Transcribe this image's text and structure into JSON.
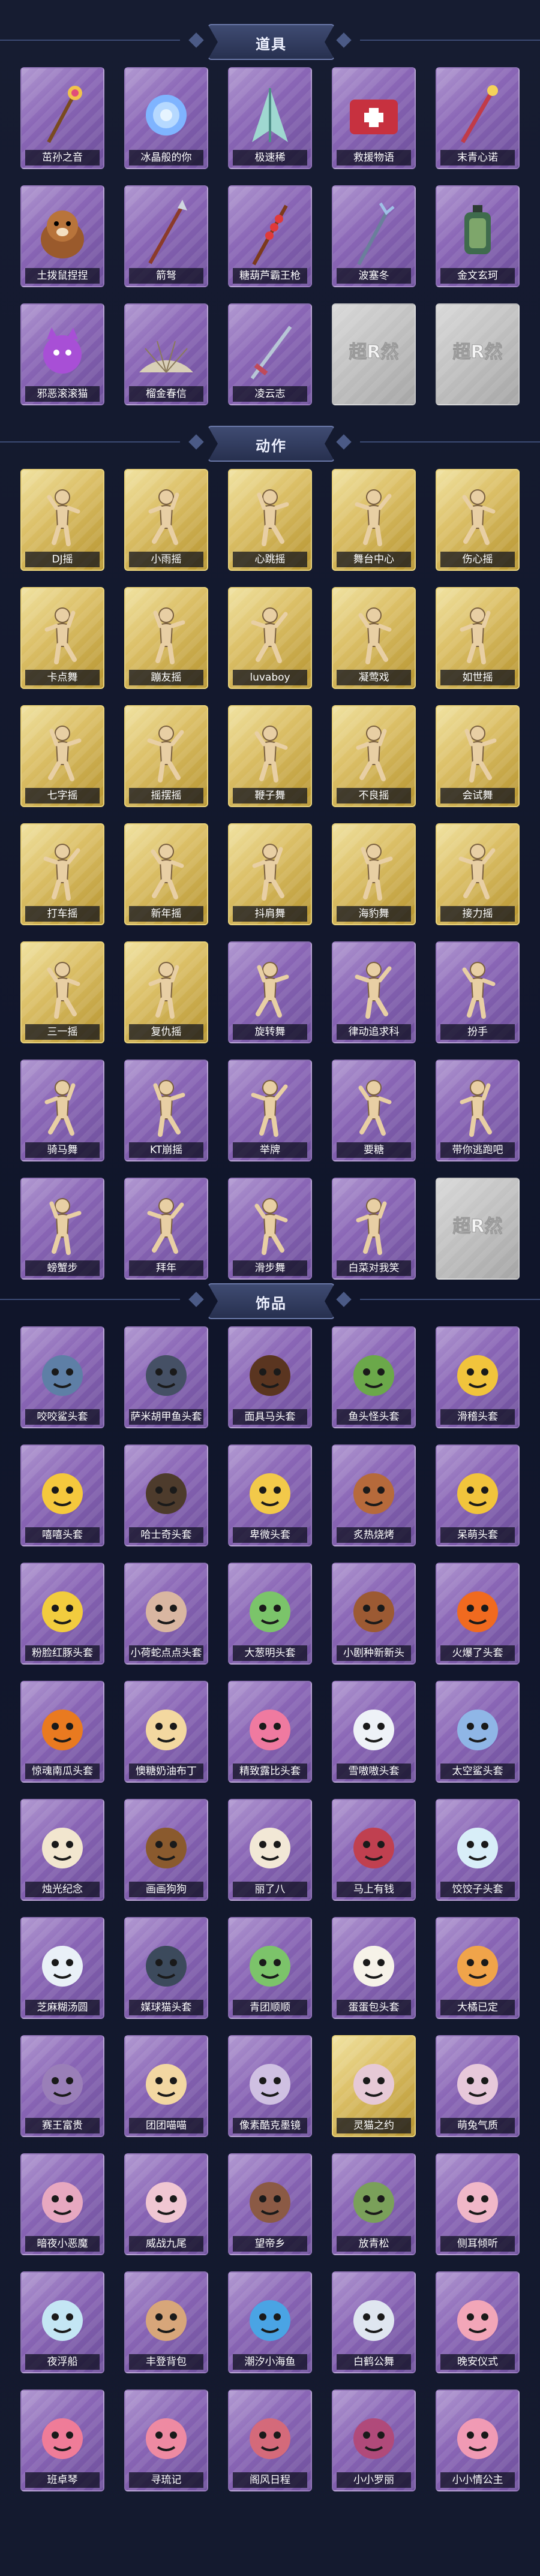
{
  "colors": {
    "background": "#141a2f",
    "rare_card": "#8a66b6",
    "legendary_card": "#dcc068",
    "locked_card": "#bfbfbf",
    "label_bg": "#0a0c1a",
    "section_ribbon": "#323c5f"
  },
  "sections": [
    {
      "title": "道具",
      "items": [
        {
          "label": "茁孙之音",
          "rarity": "purple",
          "icon": "staff-icon"
        },
        {
          "label": "冰晶般的你",
          "rarity": "purple",
          "icon": "crystal-flower-icon"
        },
        {
          "label": "极速稀",
          "rarity": "purple",
          "icon": "feather-wings-icon"
        },
        {
          "label": "救援物语",
          "rarity": "purple",
          "icon": "medkit-icon"
        },
        {
          "label": "末青心诺",
          "rarity": "purple",
          "icon": "wand-icon"
        },
        {
          "label": "土拨鼠捏捏",
          "rarity": "purple",
          "icon": "groundhog-icon"
        },
        {
          "label": "箭弩",
          "rarity": "purple",
          "icon": "spear-icon"
        },
        {
          "label": "糖葫芦霸王枪",
          "rarity": "purple",
          "icon": "candied-spear-icon"
        },
        {
          "label": "波塞冬",
          "rarity": "purple",
          "icon": "trident-icon"
        },
        {
          "label": "金文玄珂",
          "rarity": "purple",
          "icon": "lantern-icon"
        },
        {
          "label": "邪恶滚滚猫",
          "rarity": "purple",
          "icon": "purple-cat-icon"
        },
        {
          "label": "榴金春信",
          "rarity": "purple",
          "icon": "fan-icon"
        },
        {
          "label": "凌云志",
          "rarity": "purple",
          "icon": "sword-icon"
        },
        {
          "label": "",
          "rarity": "gray",
          "icon": "locked-logo-icon"
        },
        {
          "label": "",
          "rarity": "gray",
          "icon": "locked-logo-icon"
        }
      ]
    },
    {
      "title": "动作",
      "items": [
        {
          "label": "DJ摇",
          "rarity": "gold",
          "icon": "dance-pose-icon"
        },
        {
          "label": "小雨摇",
          "rarity": "gold",
          "icon": "dance-pose-icon"
        },
        {
          "label": "心跳摇",
          "rarity": "gold",
          "icon": "dance-pose-icon"
        },
        {
          "label": "舞台中心",
          "rarity": "gold",
          "icon": "dance-pose-icon"
        },
        {
          "label": "伤心摇",
          "rarity": "gold",
          "icon": "dance-pose-icon"
        },
        {
          "label": "卡点舞",
          "rarity": "gold",
          "icon": "dance-pose-icon"
        },
        {
          "label": "蹦友摇",
          "rarity": "gold",
          "icon": "dance-pose-icon"
        },
        {
          "label": "luvaboy",
          "rarity": "gold",
          "icon": "dance-pose-icon"
        },
        {
          "label": "凝莺戏",
          "rarity": "gold",
          "icon": "dance-pose-icon"
        },
        {
          "label": "如世摇",
          "rarity": "gold",
          "icon": "dance-pose-icon"
        },
        {
          "label": "七字摇",
          "rarity": "gold",
          "icon": "dance-pose-icon"
        },
        {
          "label": "摇摆摇",
          "rarity": "gold",
          "icon": "dance-pose-icon"
        },
        {
          "label": "鞭子舞",
          "rarity": "gold",
          "icon": "dance-pose-icon"
        },
        {
          "label": "不良摇",
          "rarity": "gold",
          "icon": "dance-pose-icon"
        },
        {
          "label": "会试舞",
          "rarity": "gold",
          "icon": "dance-pose-icon"
        },
        {
          "label": "打车摇",
          "rarity": "gold",
          "icon": "dance-pose-icon"
        },
        {
          "label": "新年摇",
          "rarity": "gold",
          "icon": "dance-pose-icon"
        },
        {
          "label": "抖肩舞",
          "rarity": "gold",
          "icon": "dance-pose-icon"
        },
        {
          "label": "海豹舞",
          "rarity": "gold",
          "icon": "dance-pose-icon"
        },
        {
          "label": "接力摇",
          "rarity": "gold",
          "icon": "dance-pose-icon"
        },
        {
          "label": "三一摇",
          "rarity": "gold",
          "icon": "dance-pose-icon"
        },
        {
          "label": "复仇摇",
          "rarity": "gold",
          "icon": "dance-pose-icon"
        },
        {
          "label": "旋转舞",
          "rarity": "purple",
          "icon": "dance-pose-icon"
        },
        {
          "label": "律动追求科",
          "rarity": "purple",
          "icon": "dance-pose-icon"
        },
        {
          "label": "扮手",
          "rarity": "purple",
          "icon": "dance-pose-icon"
        },
        {
          "label": "骑马舞",
          "rarity": "purple",
          "icon": "dance-pose-icon"
        },
        {
          "label": "KT崩摇",
          "rarity": "purple",
          "icon": "dance-pose-icon"
        },
        {
          "label": "举牌",
          "rarity": "purple",
          "icon": "dance-pose-icon"
        },
        {
          "label": "要糖",
          "rarity": "purple",
          "icon": "dance-pose-icon"
        },
        {
          "label": "带你逃跑吧",
          "rarity": "purple",
          "icon": "dance-pose-icon"
        },
        {
          "label": "螃蟹步",
          "rarity": "purple",
          "icon": "dance-pose-icon"
        },
        {
          "label": "拜年",
          "rarity": "purple",
          "icon": "dance-pose-icon"
        },
        {
          "label": "滑步舞",
          "rarity": "purple",
          "icon": "dance-pose-icon"
        },
        {
          "label": "白菜对我笑",
          "rarity": "purple",
          "icon": "dance-pose-icon"
        },
        {
          "label": "",
          "rarity": "gray",
          "icon": "locked-logo-icon"
        }
      ]
    },
    {
      "title": "饰品",
      "items": [
        {
          "label": "咬咬鲨头套",
          "rarity": "purple",
          "icon": "shark-head-icon"
        },
        {
          "label": "萨米胡甲鱼头套",
          "rarity": "purple",
          "icon": "seal-head-icon"
        },
        {
          "label": "面具马头套",
          "rarity": "purple",
          "icon": "horse-head-icon"
        },
        {
          "label": "鱼头怪头套",
          "rarity": "purple",
          "icon": "fish-head-icon"
        },
        {
          "label": "滑稽头套",
          "rarity": "purple",
          "icon": "funny-face-icon"
        },
        {
          "label": "嘻嘻头套",
          "rarity": "purple",
          "icon": "grin-face-icon"
        },
        {
          "label": "哈士奇头套",
          "rarity": "purple",
          "icon": "husky-head-icon"
        },
        {
          "label": "卑微头套",
          "rarity": "purple",
          "icon": "humble-face-icon"
        },
        {
          "label": "炙热烧烤",
          "rarity": "purple",
          "icon": "bbq-face-icon"
        },
        {
          "label": "呆萌头套",
          "rarity": "purple",
          "icon": "dazed-face-icon"
        },
        {
          "label": "粉脸红豚头套",
          "rarity": "purple",
          "icon": "pikachu-head-icon"
        },
        {
          "label": "小荷蛇点点头套",
          "rarity": "purple",
          "icon": "snake-head-icon"
        },
        {
          "label": "大葱明头套",
          "rarity": "purple",
          "icon": "scallion-head-icon"
        },
        {
          "label": "小剧种新新头",
          "rarity": "purple",
          "icon": "bear-head-icon"
        },
        {
          "label": "火爆了头套",
          "rarity": "purple",
          "icon": "fire-head-icon"
        },
        {
          "label": "惊魂南瓜头套",
          "rarity": "purple",
          "icon": "pumpkin-head-icon"
        },
        {
          "label": "懊糖奶油布丁",
          "rarity": "purple",
          "icon": "pudding-head-icon"
        },
        {
          "label": "精致露比头套",
          "rarity": "purple",
          "icon": "pink-beaver-head-icon"
        },
        {
          "label": "雪嗷嗷头套",
          "rarity": "purple",
          "icon": "snowman-head-icon"
        },
        {
          "label": "太空鲨头套",
          "rarity": "purple",
          "icon": "space-shark-head-icon"
        },
        {
          "label": "烛光纪念",
          "rarity": "purple",
          "icon": "candle-head-icon"
        },
        {
          "label": "画画狗狗",
          "rarity": "purple",
          "icon": "dog-head-icon"
        },
        {
          "label": "丽了八",
          "rarity": "purple",
          "icon": "bun-head-icon"
        },
        {
          "label": "马上有钱",
          "rarity": "purple",
          "icon": "horse-hat-icon"
        },
        {
          "label": "饺饺子头套",
          "rarity": "purple",
          "icon": "dumpling-head-icon"
        },
        {
          "label": "芝麻糊汤圆",
          "rarity": "purple",
          "icon": "tangyuan-head-icon"
        },
        {
          "label": "媒球猫头套",
          "rarity": "purple",
          "icon": "black-cat-head-icon"
        },
        {
          "label": "青团顺顺",
          "rarity": "purple",
          "icon": "green-bun-head-icon"
        },
        {
          "label": "蛋蛋包头套",
          "rarity": "purple",
          "icon": "egg-head-icon"
        },
        {
          "label": "大橘已定",
          "rarity": "purple",
          "icon": "orange-head-icon"
        },
        {
          "label": "赛王富贵",
          "rarity": "purple",
          "icon": "hat-accessory-icon"
        },
        {
          "label": "团团喵喵",
          "rarity": "purple",
          "icon": "cat-head-icon"
        },
        {
          "label": "像素酷克墨镜",
          "rarity": "purple",
          "icon": "pixel-glasses-icon"
        },
        {
          "label": "灵猫之约",
          "rarity": "gold",
          "icon": "spirit-cat-icon"
        },
        {
          "label": "萌兔气质",
          "rarity": "purple",
          "icon": "rabbit-head-icon"
        },
        {
          "label": "暗夜小恶魔",
          "rarity": "purple",
          "icon": "devil-head-icon"
        },
        {
          "label": "威战九尾",
          "rarity": "purple",
          "icon": "fox-head-icon"
        },
        {
          "label": "望帝乡",
          "rarity": "purple",
          "icon": "beast-head-icon"
        },
        {
          "label": "放青松",
          "rarity": "purple",
          "icon": "bonsai-head-icon"
        },
        {
          "label": "侧耳倾听",
          "rarity": "purple",
          "icon": "pink-bunny-head-icon"
        },
        {
          "label": "夜浮船",
          "rarity": "purple",
          "icon": "ice-crown-icon"
        },
        {
          "label": "丰登背包",
          "rarity": "purple",
          "icon": "cake-backpack-icon"
        },
        {
          "label": "潮汐小海鱼",
          "rarity": "purple",
          "icon": "blue-cat-icon"
        },
        {
          "label": "白鹤公舞",
          "rarity": "purple",
          "icon": "ghost-head-icon"
        },
        {
          "label": "晚安仪式",
          "rarity": "purple",
          "icon": "pink-girl-icon"
        },
        {
          "label": "班卓琴",
          "rarity": "purple",
          "icon": "pink-beaver-doll-icon"
        },
        {
          "label": "寻琉记",
          "rarity": "purple",
          "icon": "cowgirl-doll-icon"
        },
        {
          "label": "阁风日程",
          "rarity": "purple",
          "icon": "penguin-girl-icon"
        },
        {
          "label": "小小罗丽",
          "rarity": "purple",
          "icon": "princess-doll-icon"
        },
        {
          "label": "小小情公主",
          "rarity": "purple",
          "icon": "fairy-doll-icon"
        }
      ]
    }
  ]
}
